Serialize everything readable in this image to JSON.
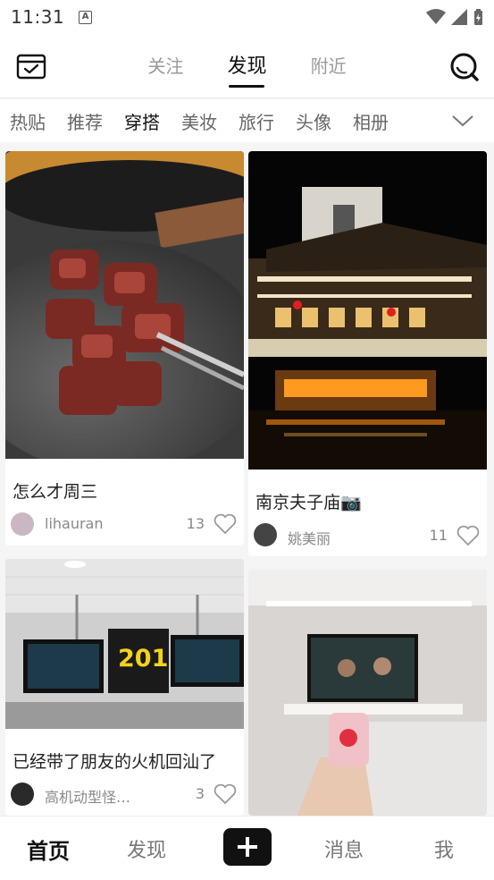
{
  "status_bar": {
    "time": "11:31",
    "a_icon": "A"
  },
  "header": {
    "tabs": [
      {
        "label": "关注",
        "active": false
      },
      {
        "label": "发现",
        "active": true
      },
      {
        "label": "附近",
        "active": false
      }
    ]
  },
  "categories": [
    {
      "label": "热贴",
      "active": false
    },
    {
      "label": "推荐",
      "active": false
    },
    {
      "label": "穿搭",
      "active": true
    },
    {
      "label": "美妆",
      "active": false
    },
    {
      "label": "旅行",
      "active": false
    },
    {
      "label": "头像",
      "active": false
    },
    {
      "label": "相册",
      "active": false
    }
  ],
  "feed": [
    {
      "title": "怎么才周三",
      "author": "lihauran",
      "likes": "13",
      "image": "grilled-steak-photo"
    },
    {
      "title": "南京夫子庙📷",
      "author": "姚美丽",
      "likes": "11",
      "image": "nanjing-night-photo"
    },
    {
      "title": "已经带了朋友的火机回汕了",
      "author": "高机动型怪…",
      "likes": "3",
      "image": "airport-gate-photo",
      "gate": "201"
    },
    {
      "title": "",
      "author": "",
      "likes": "",
      "image": "hotel-tv-photo"
    }
  ],
  "bottom_nav": {
    "home": "首页",
    "discover": "发现",
    "messages": "消息",
    "me": "我"
  },
  "colors": {
    "accent": "#111111",
    "muted": "#888888",
    "background": "#f5f5f5"
  }
}
